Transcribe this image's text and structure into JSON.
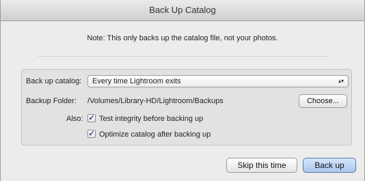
{
  "window": {
    "title": "Back Up Catalog"
  },
  "note": "Note: This only backs up the catalog file, not your photos.",
  "backup_catalog": {
    "label": "Back up catalog:",
    "selected": "Every time Lightroom exits"
  },
  "backup_folder": {
    "label": "Backup Folder:",
    "path": "/Volumes/Library-HD/Lightroom/Backups",
    "choose_label": "Choose..."
  },
  "also": {
    "label": "Also:",
    "options": [
      {
        "label": "Test integrity before backing up",
        "checked": true
      },
      {
        "label": "Optimize catalog after backing up",
        "checked": true
      }
    ]
  },
  "buttons": {
    "skip": "Skip this time",
    "backup": "Back up"
  },
  "icons": {
    "select_arrows": "updown-chevron-icon",
    "checkmark": "checkmark-icon"
  }
}
